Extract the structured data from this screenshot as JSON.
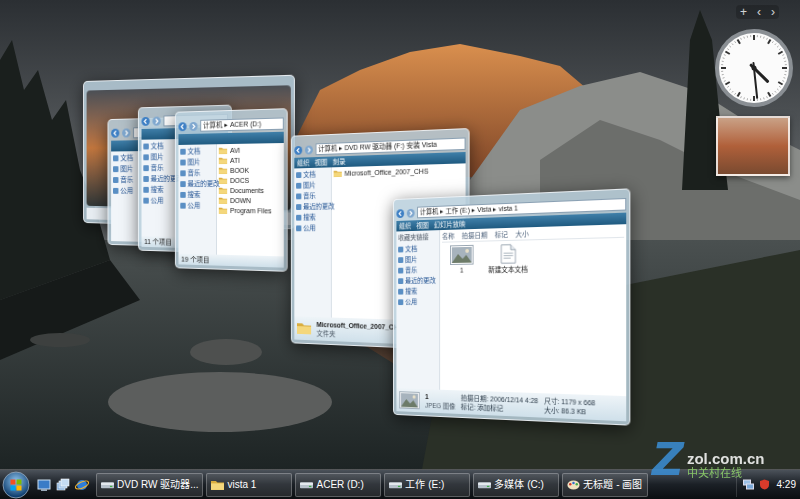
{
  "gadget_controls": [
    "+",
    "‹",
    "›"
  ],
  "clock": {
    "hour": 4,
    "minute": 29
  },
  "windows": [
    {
      "kind": "photo"
    },
    {
      "kind": "explorer",
      "nav": [
        "文档",
        "图片",
        "音乐",
        "公用"
      ]
    },
    {
      "kind": "explorer",
      "nav": [
        "文档",
        "图片",
        "音乐",
        "最近的更改",
        "搜索",
        "公用"
      ],
      "status": "11 个项目"
    },
    {
      "kind": "explorer",
      "address": "计算机 ▸ ACER (D:)",
      "nav": [
        "文档",
        "图片",
        "音乐",
        "最近的更改",
        "搜索",
        "公用"
      ],
      "items": [
        {
          "label": "AVI",
          "kind": "folder"
        },
        {
          "label": "ATI",
          "kind": "folder"
        },
        {
          "label": "BOOK",
          "kind": "folder"
        },
        {
          "label": "DOCS",
          "kind": "folder"
        },
        {
          "label": "Documents",
          "kind": "folder"
        },
        {
          "label": "DOWN",
          "kind": "folder"
        },
        {
          "label": "Program Files",
          "kind": "folder"
        }
      ],
      "status": "19 个项目"
    },
    {
      "kind": "explorer",
      "address": "计算机 ▸ DVD RW 驱动器 (F:) 安装 Vista",
      "toolbar": [
        "组织",
        "视图",
        "刻录"
      ],
      "nav": [
        "文档",
        "图片",
        "音乐",
        "最近的更改",
        "搜索",
        "公用"
      ],
      "items": [
        {
          "label": "Microsoft_Office_2007_CHS",
          "kind": "folder"
        }
      ],
      "details": {
        "name": "Microsoft_Office_2007_CHS",
        "type": "文件夹",
        "fields": []
      }
    },
    {
      "kind": "explorer",
      "address": "计算机 ▸ 工作 (E:) ▸ Vista ▸ vista 1",
      "toolbar": [
        "组织",
        "视图",
        "幻灯片放映"
      ],
      "nav_title": "收藏夹链接",
      "nav": [
        "文档",
        "图片",
        "音乐",
        "最近的更改",
        "搜索",
        "公用"
      ],
      "columns": [
        "名称",
        "拍摄日期",
        "标记",
        "大小"
      ],
      "items": [
        {
          "label": "1",
          "kind": "image"
        },
        {
          "label": "新建文本文档",
          "kind": "text"
        }
      ],
      "details": {
        "name": "1",
        "type": "JPEG 图像",
        "fields": [
          "拍摄日期: 2006/12/14 4:28",
          "尺寸: 1179 x 668",
          "标记: 添加标记",
          "大小: 86.3 KB"
        ]
      }
    }
  ],
  "taskbar": {
    "buttons": [
      {
        "label": "DVD RW 驱动器...",
        "kind": "drive"
      },
      {
        "label": "vista 1",
        "kind": "folder"
      },
      {
        "label": "ACER (D:)",
        "kind": "drive"
      },
      {
        "label": "工作 (E:)",
        "kind": "drive"
      },
      {
        "label": "多媒体 (C:)",
        "kind": "drive"
      },
      {
        "label": "无标题 - 画图",
        "kind": "paint"
      }
    ],
    "time": "4:29"
  },
  "watermark": {
    "logo": "Z",
    "site": "zol.com.cn",
    "name": "中关村在线"
  }
}
